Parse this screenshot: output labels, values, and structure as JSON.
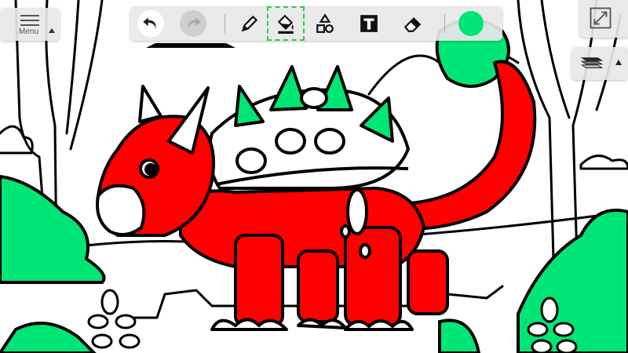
{
  "app": {
    "menu_label": "Menu"
  },
  "toolbar": {
    "tools": [
      {
        "name": "undo",
        "icon": "undo-icon"
      },
      {
        "name": "redo",
        "icon": "redo-icon",
        "disabled": true
      },
      {
        "name": "pencil",
        "icon": "pencil-icon"
      },
      {
        "name": "fill",
        "icon": "paint-bucket-icon",
        "selected": true
      },
      {
        "name": "shapes",
        "icon": "shapes-icon"
      },
      {
        "name": "text",
        "icon": "text-icon",
        "glyph": "T"
      },
      {
        "name": "eraser",
        "icon": "eraser-icon"
      }
    ],
    "current_color": "#00e676"
  },
  "colors": {
    "red_fill": "#ff0000",
    "green_fill": "#00e676",
    "line": "#000000",
    "selected_outline": "#2ecc40"
  },
  "icons": {
    "fullscreen": "expand-diagonal-icon",
    "layers": "layers-icon"
  }
}
